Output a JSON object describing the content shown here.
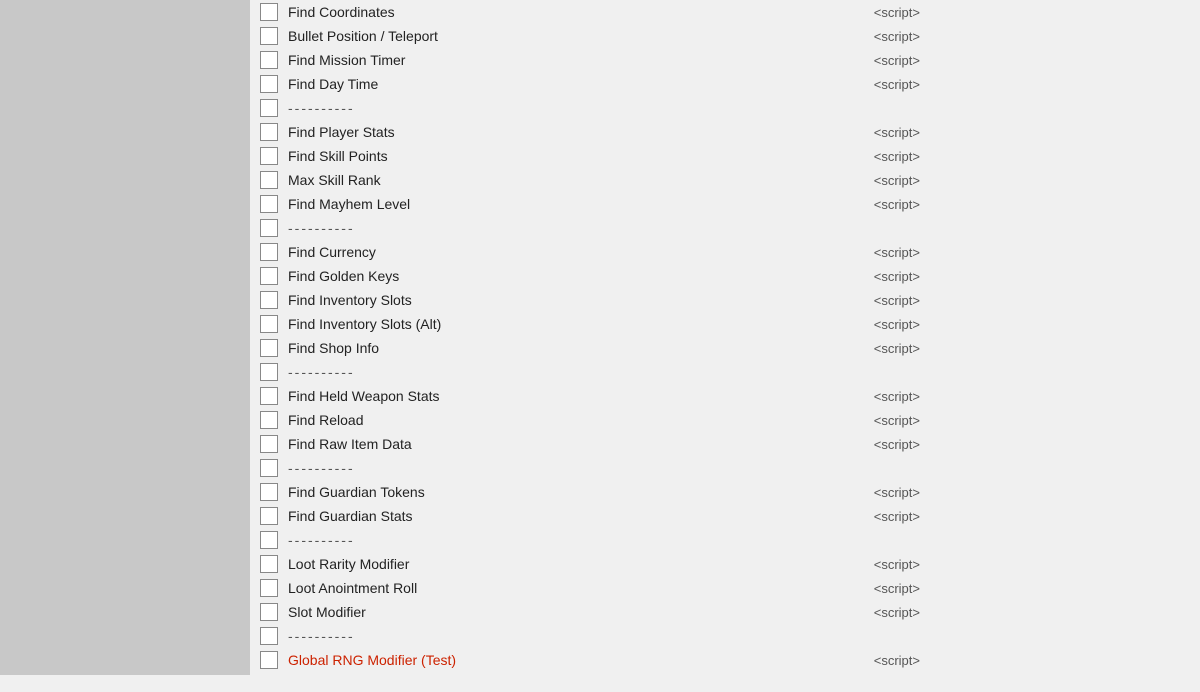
{
  "leftPanel": {
    "background": "#c8c8c8"
  },
  "items": [
    {
      "type": "item",
      "label": "Find Coordinates",
      "hasScript": true,
      "labelClass": ""
    },
    {
      "type": "item",
      "label": "Bullet Position / Teleport",
      "hasScript": true,
      "labelClass": ""
    },
    {
      "type": "item",
      "label": "Find Mission Timer",
      "hasScript": true,
      "labelClass": ""
    },
    {
      "type": "item",
      "label": "Find Day Time",
      "hasScript": true,
      "labelClass": ""
    },
    {
      "type": "separator",
      "label": "----------"
    },
    {
      "type": "item",
      "label": "Find Player Stats",
      "hasScript": true,
      "labelClass": ""
    },
    {
      "type": "item",
      "label": "Find Skill Points",
      "hasScript": true,
      "labelClass": ""
    },
    {
      "type": "item",
      "label": "Max Skill Rank",
      "hasScript": true,
      "labelClass": ""
    },
    {
      "type": "item",
      "label": "Find Mayhem Level",
      "hasScript": true,
      "labelClass": ""
    },
    {
      "type": "separator",
      "label": "----------"
    },
    {
      "type": "item",
      "label": "Find Currency",
      "hasScript": true,
      "labelClass": ""
    },
    {
      "type": "item",
      "label": "Find Golden Keys",
      "hasScript": true,
      "labelClass": ""
    },
    {
      "type": "item",
      "label": "Find Inventory Slots",
      "hasScript": true,
      "labelClass": ""
    },
    {
      "type": "item",
      "label": "Find Inventory Slots (Alt)",
      "hasScript": true,
      "labelClass": ""
    },
    {
      "type": "item",
      "label": "Find Shop Info",
      "hasScript": true,
      "labelClass": ""
    },
    {
      "type": "separator",
      "label": "----------"
    },
    {
      "type": "item",
      "label": "Find Held Weapon Stats",
      "hasScript": true,
      "labelClass": ""
    },
    {
      "type": "item",
      "label": "Find Reload",
      "hasScript": true,
      "labelClass": ""
    },
    {
      "type": "item",
      "label": "Find Raw Item Data",
      "hasScript": true,
      "labelClass": ""
    },
    {
      "type": "separator",
      "label": "----------"
    },
    {
      "type": "item",
      "label": "Find Guardian Tokens",
      "hasScript": true,
      "labelClass": ""
    },
    {
      "type": "item",
      "label": "Find Guardian Stats",
      "hasScript": true,
      "labelClass": ""
    },
    {
      "type": "separator",
      "label": "----------"
    },
    {
      "type": "item",
      "label": "Loot Rarity Modifier",
      "hasScript": true,
      "labelClass": ""
    },
    {
      "type": "item",
      "label": "Loot Anointment Roll",
      "hasScript": true,
      "labelClass": ""
    },
    {
      "type": "item",
      "label": "Slot Modifier",
      "hasScript": true,
      "labelClass": ""
    },
    {
      "type": "separator",
      "label": "----------"
    },
    {
      "type": "item",
      "label": "Global RNG Modifier (Test)",
      "hasScript": true,
      "labelClass": "red"
    }
  ],
  "scriptTag": "<script>"
}
